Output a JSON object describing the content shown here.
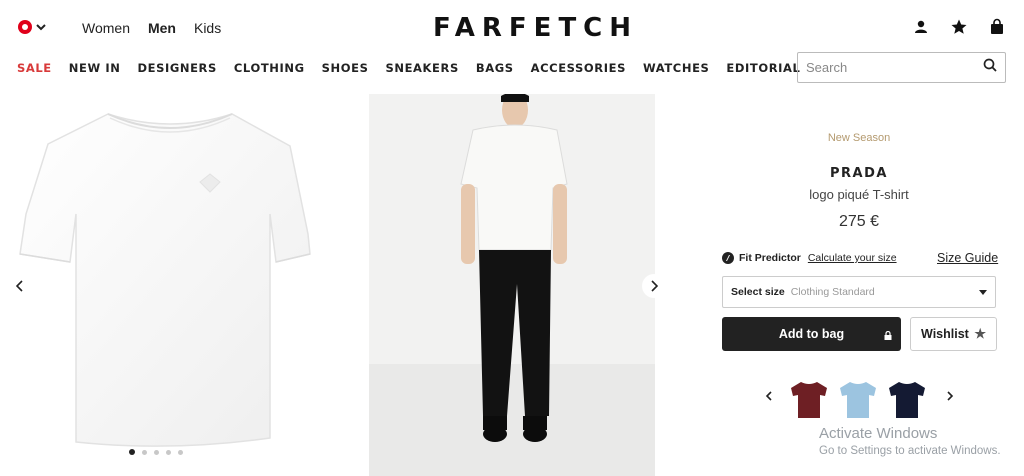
{
  "header": {
    "region_icon": "region-flag-icon",
    "gender_tabs": [
      {
        "label": "Women",
        "active": false
      },
      {
        "label": "Men",
        "active": true
      },
      {
        "label": "Kids",
        "active": false
      }
    ],
    "logo": "FARFETCH",
    "icons": [
      "account-icon",
      "wishlist-star-icon",
      "shopping-bag-icon"
    ]
  },
  "nav": {
    "items": [
      "SALE",
      "NEW IN",
      "DESIGNERS",
      "CLOTHING",
      "SHOES",
      "SNEAKERS",
      "BAGS",
      "ACCESSORIES",
      "WATCHES",
      "EDITORIAL"
    ],
    "sale_color": "#d83a3a"
  },
  "search": {
    "placeholder": "Search",
    "value": ""
  },
  "gallery": {
    "images": [
      "white-tshirt-flat-image",
      "model-wearing-tshirt-image"
    ],
    "dot_count": 5,
    "active_dot": 0
  },
  "product": {
    "season": "New Season",
    "brand": "PRADA",
    "name": "logo piqué T-shirt",
    "price": "275 €",
    "fit_label": "Fit Predictor",
    "fit_link": "Calculate your size",
    "size_guide": "Size Guide",
    "size_select_label": "Select size",
    "size_select_value": "Clothing Standard",
    "add_to_bag": "Add to bag",
    "wishlist": "Wishlist"
  },
  "related_colors": [
    {
      "name": "burgundy-tshirt",
      "color": "#6e1f24"
    },
    {
      "name": "light-blue-tshirt",
      "color": "#9cc4e0"
    },
    {
      "name": "navy-tshirt",
      "color": "#141a33"
    }
  ],
  "watermark": {
    "title": "Activate Windows",
    "subtitle": "Go to Settings to activate Windows."
  },
  "colors": {
    "accent": "#222222",
    "season": "#b49a6f"
  }
}
